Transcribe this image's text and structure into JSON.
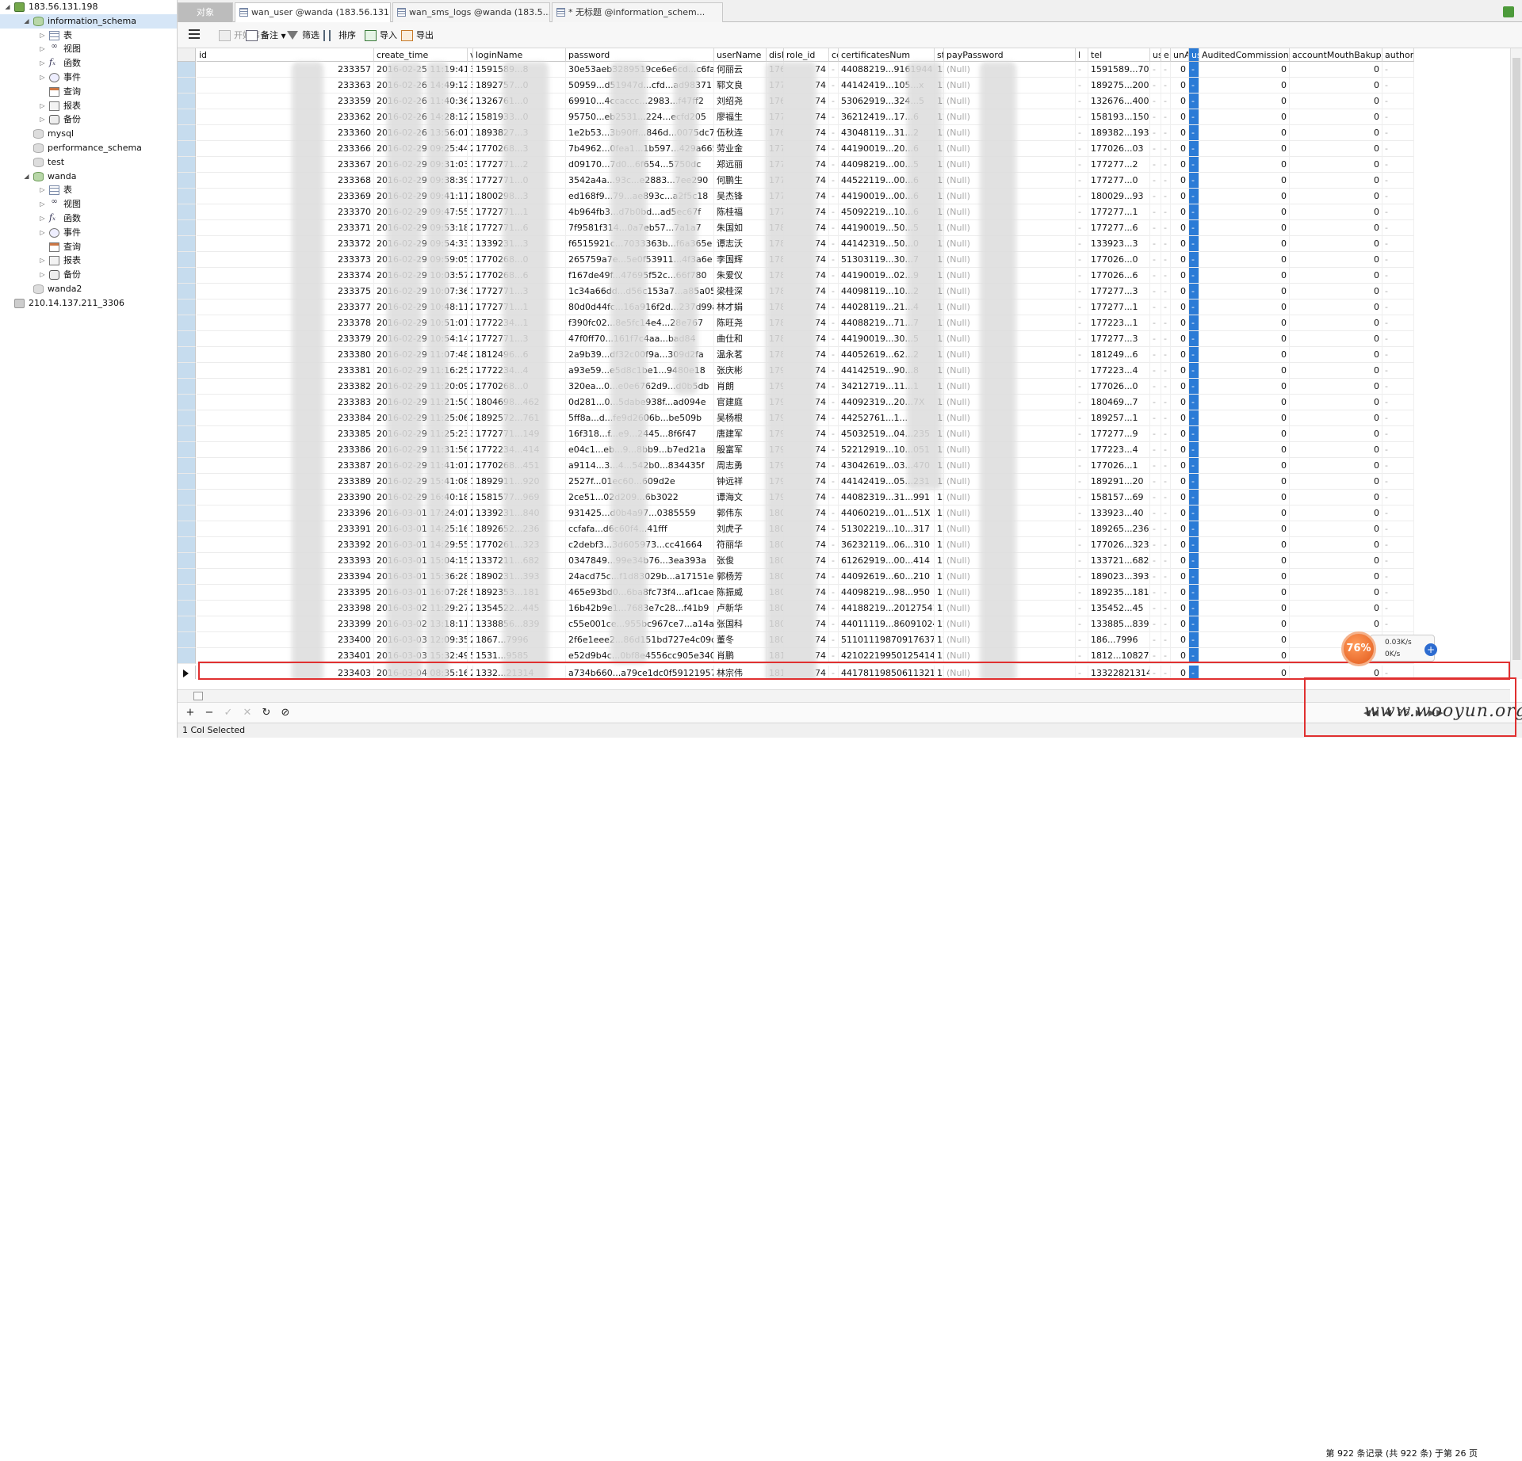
{
  "left_tree": [
    {
      "label": "183.56.131.198",
      "kind": "server",
      "depth": 0,
      "twist": "◢"
    },
    {
      "label": "information_schema",
      "kind": "db",
      "depth": 1,
      "twist": "◢",
      "selected": true
    },
    {
      "label": "表",
      "kind": "grid",
      "depth": 2,
      "twist": "▷"
    },
    {
      "label": "视图",
      "kind": "glasses",
      "depth": 2,
      "twist": "▷"
    },
    {
      "label": "函数",
      "kind": "fx",
      "depth": 2,
      "twist": "▷"
    },
    {
      "label": "事件",
      "kind": "event",
      "depth": 2,
      "twist": "▷"
    },
    {
      "label": "查询",
      "kind": "query",
      "depth": 2,
      "twist": ""
    },
    {
      "label": "报表",
      "kind": "report",
      "depth": 2,
      "twist": "▷"
    },
    {
      "label": "备份",
      "kind": "backup",
      "depth": 2,
      "twist": "▷"
    },
    {
      "label": "mysql",
      "kind": "db-dim",
      "depth": 1,
      "twist": ""
    },
    {
      "label": "performance_schema",
      "kind": "db-dim",
      "depth": 1,
      "twist": ""
    },
    {
      "label": "test",
      "kind": "db-dim",
      "depth": 1,
      "twist": ""
    },
    {
      "label": "wanda",
      "kind": "db",
      "depth": 1,
      "twist": "◢"
    },
    {
      "label": "表",
      "kind": "grid",
      "depth": 2,
      "twist": "▷"
    },
    {
      "label": "视图",
      "kind": "glasses",
      "depth": 2,
      "twist": "▷"
    },
    {
      "label": "函数",
      "kind": "fx",
      "depth": 2,
      "twist": "▷"
    },
    {
      "label": "事件",
      "kind": "event",
      "depth": 2,
      "twist": "▷"
    },
    {
      "label": "查询",
      "kind": "query",
      "depth": 2,
      "twist": ""
    },
    {
      "label": "报表",
      "kind": "report",
      "depth": 2,
      "twist": "▷"
    },
    {
      "label": "备份",
      "kind": "backup",
      "depth": 2,
      "twist": "▷"
    },
    {
      "label": "wanda2",
      "kind": "db-dim",
      "depth": 1,
      "twist": ""
    },
    {
      "label": "210.14.137.211_3306",
      "kind": "server-dim",
      "depth": 0,
      "twist": ""
    }
  ],
  "tabs": [
    {
      "label": "对象",
      "kind": "obj"
    },
    {
      "label": "wan_user @wanda (183.56.131....",
      "kind": "table",
      "active": true
    },
    {
      "label": "wan_sms_logs @wanda (183.5...",
      "kind": "table"
    },
    {
      "label": "* 无标题 @information_schem...",
      "kind": "query"
    }
  ],
  "toolbar": {
    "begin_transaction": "开始事务",
    "memo": "备注",
    "filter": "筛选",
    "sort": "排序",
    "import": "导入",
    "export": "导出"
  },
  "columns": [
    "id",
    "create_time",
    "v",
    "loginName",
    "password",
    "userName",
    "disIc",
    "role_id",
    "cе",
    "certificatesNum",
    "sta",
    "payPassword",
    "l",
    "tel",
    "use",
    "e",
    "unA",
    "us",
    "AuditedCommission",
    "accountMouthBakup",
    "author"
  ],
  "null_text": "(Null)",
  "rows": [
    {
      "id": "233357",
      "ct": "2016-02-25 11:19:41",
      "v": "3",
      "login": "1591589...8",
      "pw": "30e53aeb3289519ce6e6cd...c6faf1c",
      "user": "何丽云",
      "dis": "1766",
      "role": "74",
      "cert": "44088219...9161944",
      "sta": "12",
      "tel": "1591589...708",
      "ac": "0",
      "am": "0"
    },
    {
      "id": "233363",
      "ct": "2016-02-26 14:49:12",
      "v": "3",
      "login": "1892757...0",
      "pw": "50959...d51947d...cfd...ad98371",
      "user": "郓文良",
      "dis": "1772",
      "role": "74",
      "cert": "44142419...105...x",
      "sta": "12",
      "tel": "189275...200",
      "ac": "0",
      "am": "0"
    },
    {
      "id": "233359",
      "ct": "2016-02-26 11:40:36",
      "v": "2",
      "login": "1326761...0",
      "pw": "69910...4ccaccc...2983...f47ff2",
      "user": "刘绍尧",
      "dis": "1768",
      "role": "74",
      "cert": "53062919...324...5",
      "sta": "12",
      "tel": "132676...400",
      "ac": "0",
      "am": "0"
    },
    {
      "id": "233362",
      "ct": "2016-02-26 14:28:12",
      "v": "2",
      "login": "1581933...0",
      "pw": "95750...eb2531...224...ecfd205",
      "user": "廖福生",
      "dis": "1771",
      "role": "74",
      "cert": "36212419...17...6",
      "sta": "12",
      "tel": "158193...150",
      "ac": "0",
      "am": "0"
    },
    {
      "id": "233360",
      "ct": "2016-02-26 13:56:01",
      "v": "1",
      "login": "1893827...3",
      "pw": "1e2b53...3b90ff...846d...0075dc7",
      "user": "伍秋连",
      "dis": "1769",
      "role": "74",
      "cert": "43048119...31...2",
      "sta": "12",
      "tel": "189382...193",
      "ac": "0",
      "am": "0"
    },
    {
      "id": "233366",
      "ct": "2016-02-29 09:25:44",
      "v": "2",
      "login": "1770268...3",
      "pw": "7b4962...0fea1...1b597...429a665",
      "user": "劳业金",
      "dis": "1775",
      "role": "74",
      "cert": "44190019...20...6",
      "sta": "12",
      "tel": "177026...03",
      "ac": "0",
      "am": "0"
    },
    {
      "id": "233367",
      "ct": "2016-02-29 09:31:03",
      "v": "1",
      "login": "1772771...2",
      "pw": "d09170...7d0...6f654...5750dc",
      "user": "郑远丽",
      "dis": "1776",
      "role": "74",
      "cert": "44098219...00...5",
      "sta": "12",
      "tel": "177277...2",
      "ac": "0",
      "am": "0"
    },
    {
      "id": "233368",
      "ct": "2016-02-29 09:38:39",
      "v": "1",
      "login": "1772771...0",
      "pw": "3542a4a...93c...e2883...7ee290",
      "user": "何鹏生",
      "dis": "1777",
      "role": "74",
      "cert": "44522119...00...6",
      "sta": "12",
      "tel": "177277...0",
      "ac": "0",
      "am": "0"
    },
    {
      "id": "233369",
      "ct": "2016-02-29 09:41:11",
      "v": "2",
      "login": "1800298...3",
      "pw": "ed168f9...79...ae893c...a2f5c18",
      "user": "吴杰锋",
      "dis": "1778",
      "role": "74",
      "cert": "44190019...00...6",
      "sta": "12",
      "tel": "180029...93",
      "ac": "0",
      "am": "0"
    },
    {
      "id": "233370",
      "ct": "2016-02-29 09:47:55",
      "v": "1",
      "login": "1772771...1",
      "pw": "4b964fb3...d7b0bd...ad5ec67f",
      "user": "陈桂福",
      "dis": "1779",
      "role": "74",
      "cert": "45092219...10...6",
      "sta": "12",
      "tel": "177277...1",
      "ac": "0",
      "am": "0"
    },
    {
      "id": "233371",
      "ct": "2016-02-29 09:53:18",
      "v": "2",
      "login": "1772771...6",
      "pw": "7f9581f314...0a7eb57...7a1a7",
      "user": "朱国如",
      "dis": "1780",
      "role": "74",
      "cert": "44190019...50...5",
      "sta": "12",
      "tel": "177277...6",
      "ac": "0",
      "am": "0"
    },
    {
      "id": "233372",
      "ct": "2016-02-29 09:54:33",
      "v": "1",
      "login": "1339231...3",
      "pw": "f6515921c...7033363b...f6a365e",
      "user": "谭志沃",
      "dis": "1781",
      "role": "74",
      "cert": "44142319...50...0",
      "sta": "12",
      "tel": "133923...3",
      "ac": "0",
      "am": "0"
    },
    {
      "id": "233373",
      "ct": "2016-02-29 09:59:05",
      "v": "1",
      "login": "1770268...0",
      "pw": "265759a7e...5e0f53911...4f3a6e",
      "user": "李国辉",
      "dis": "1782",
      "role": "74",
      "cert": "51303119...30...7",
      "sta": "12",
      "tel": "177026...0",
      "ac": "0",
      "am": "0"
    },
    {
      "id": "233374",
      "ct": "2016-02-29 10:03:57",
      "v": "2",
      "login": "1770268...6",
      "pw": "f167de49f...47695f52c...66f780",
      "user": "朱爱仪",
      "dis": "1783",
      "role": "74",
      "cert": "44190019...02...9",
      "sta": "12",
      "tel": "177026...6",
      "ac": "0",
      "am": "0"
    },
    {
      "id": "233375",
      "ct": "2016-02-29 10:07:36",
      "v": "1",
      "login": "1772771...3",
      "pw": "1c34a66dd...d56c153a7...a85a057",
      "user": "梁桂深",
      "dis": "1784",
      "role": "74",
      "cert": "44098119...10...2",
      "sta": "12",
      "tel": "177277...3",
      "ac": "0",
      "am": "0"
    },
    {
      "id": "233377",
      "ct": "2016-02-29 10:48:11",
      "v": "2",
      "login": "1772771...1",
      "pw": "80d0d44fc...16a916f2d...237d99a",
      "user": "林才娟",
      "dis": "1786",
      "role": "74",
      "cert": "44028119...21...4",
      "sta": "12",
      "tel": "177277...1",
      "ac": "0",
      "am": "0"
    },
    {
      "id": "233378",
      "ct": "2016-02-29 10:51:01",
      "v": "3",
      "login": "1772234...1",
      "pw": "f390fc02...8e5fc14e4...28e767",
      "user": "陈旺尧",
      "dis": "1787",
      "role": "74",
      "cert": "44088219...71...7",
      "sta": "12",
      "tel": "177223...1",
      "ac": "0",
      "am": "0"
    },
    {
      "id": "233379",
      "ct": "2016-02-29 10:54:14",
      "v": "2",
      "login": "1772771...3",
      "pw": "47f0ff70...161f7c4aa...bad84",
      "user": "曲仕和",
      "dis": "1788",
      "role": "74",
      "cert": "44190019...30...5",
      "sta": "12",
      "tel": "177277...3",
      "ac": "0",
      "am": "0"
    },
    {
      "id": "233380",
      "ct": "2016-02-29 11:07:48",
      "v": "2",
      "login": "1812496...6",
      "pw": "2a9b39...df32c00f9a...309d2fa",
      "user": "温永茗",
      "dis": "1789",
      "role": "74",
      "cert": "44052619...62...2",
      "sta": "12",
      "tel": "181249...6",
      "ac": "0",
      "am": "0"
    },
    {
      "id": "233381",
      "ct": "2016-02-29 11:16:25",
      "v": "2",
      "login": "1772234...4",
      "pw": "a93e59...e5d8c1be1...9480e18",
      "user": "张庆彬",
      "dis": "1790",
      "role": "74",
      "cert": "44142519...90...8",
      "sta": "12",
      "tel": "177223...4",
      "ac": "0",
      "am": "0"
    },
    {
      "id": "233382",
      "ct": "2016-02-29 11:20:09",
      "v": "2",
      "login": "1770268...0",
      "pw": "320ea...0...e0e6762d9...d0b5db",
      "user": "肖朗",
      "dis": "1791",
      "role": "74",
      "cert": "34212719...11...1",
      "sta": "12",
      "tel": "177026...0",
      "ac": "0",
      "am": "0"
    },
    {
      "id": "233383",
      "ct": "2016-02-29 11:21:50",
      "v": "1",
      "login": "1804698...462",
      "pw": "0d281...0...5dabe938f...ad094e",
      "user": "官建庭",
      "dis": "1792",
      "role": "74",
      "cert": "44092319...20...7X",
      "sta": "12",
      "tel": "180469...7",
      "ac": "0",
      "am": "0"
    },
    {
      "id": "233384",
      "ct": "2016-02-29 11:25:06",
      "v": "2",
      "login": "1892572...761",
      "pw": "5ff8a...d...fe9d2606b...be509b",
      "user": "吴杨根",
      "dis": "1793",
      "role": "74",
      "cert": "44252761...1...",
      "sta": "12",
      "tel": "189257...1",
      "ac": "0",
      "am": "0"
    },
    {
      "id": "233385",
      "ct": "2016-02-29 11:25:23",
      "v": "3",
      "login": "1772771...149",
      "pw": "16f318...f...e9...2445...8f6f47",
      "user": "唐建军",
      "dis": "1794",
      "role": "74",
      "cert": "45032519...04...235",
      "sta": "12",
      "tel": "177277...9",
      "ac": "0",
      "am": "0"
    },
    {
      "id": "233386",
      "ct": "2016-02-29 11:31:56",
      "v": "2",
      "login": "1772234...414",
      "pw": "e04c1...eb...9...8bb9...b7ed21a",
      "user": "殷富军",
      "dis": "1795",
      "role": "74",
      "cert": "52212919...10...051",
      "sta": "12",
      "tel": "177223...4",
      "ac": "0",
      "am": "0"
    },
    {
      "id": "233387",
      "ct": "2016-02-29 11:41:01",
      "v": "2",
      "login": "1770268...451",
      "pw": "a9114...3...4...542b0...834435f",
      "user": "周志勇",
      "dis": "1796",
      "role": "74",
      "cert": "43042619...03...470",
      "sta": "12",
      "tel": "177026...1",
      "ac": "0",
      "am": "0"
    },
    {
      "id": "233389",
      "ct": "2016-02-29 15:41:08",
      "v": "1",
      "login": "1892911...920",
      "pw": "2527f...01ec60...609d2e",
      "user": "钟远祥",
      "dis": "1798",
      "role": "74",
      "cert": "44142419...05...231",
      "sta": "12",
      "tel": "189291...20",
      "ac": "0",
      "am": "0"
    },
    {
      "id": "233390",
      "ct": "2016-02-29 16:40:18",
      "v": "2",
      "login": "1581577...969",
      "pw": "2ce51...02d209...6b3022",
      "user": "谭海文",
      "dis": "1799",
      "role": "74",
      "cert": "44082319...31...991",
      "sta": "12",
      "tel": "158157...69",
      "ac": "0",
      "am": "0"
    },
    {
      "id": "233396",
      "ct": "2016-03-01 17:24:01",
      "v": "2",
      "login": "1339231...840",
      "pw": "931425...d0b4a97...0385559",
      "user": "郭伟东",
      "dis": "1805",
      "role": "74",
      "cert": "44060219...01...51X",
      "sta": "12",
      "tel": "133923...40",
      "ac": "0",
      "am": "0"
    },
    {
      "id": "233391",
      "ct": "2016-03-01 14:25:16",
      "v": "1",
      "login": "1892652...236",
      "pw": "ccfafa...d6c60f4...41fff",
      "user": "刘虎子",
      "dis": "1800",
      "role": "74",
      "cert": "51302219...10...317",
      "sta": "12",
      "tel": "189265...236",
      "ac": "0",
      "am": "0"
    },
    {
      "id": "233392",
      "ct": "2016-03-01 14:29:55",
      "v": "1",
      "login": "1770261...323",
      "pw": "c2debf3...3d605973...cc41664",
      "user": "符丽华",
      "dis": "1801",
      "role": "74",
      "cert": "36232119...06...310",
      "sta": "12",
      "tel": "177026...323",
      "ac": "0",
      "am": "0"
    },
    {
      "id": "233393",
      "ct": "2016-03-01 15:04:15",
      "v": "2",
      "login": "1337211...682",
      "pw": "0347849...99e34b76...3ea393a",
      "user": "张俊",
      "dis": "1802",
      "role": "74",
      "cert": "61262919...00...414",
      "sta": "12",
      "tel": "133721...682",
      "ac": "0",
      "am": "0"
    },
    {
      "id": "233394",
      "ct": "2016-03-01 15:36:28",
      "v": "1",
      "login": "1890231...393",
      "pw": "24acd75c...f1d83029b...a17151e",
      "user": "郭杨芳",
      "dis": "1803",
      "role": "74",
      "cert": "44092619...60...210",
      "sta": "12",
      "tel": "189023...393",
      "ac": "0",
      "am": "0"
    },
    {
      "id": "233395",
      "ct": "2016-03-01 16:07:28",
      "v": "5",
      "login": "1892353...181",
      "pw": "465e93bd0...6ba8fc73f4...af1cae5",
      "user": "陈振威",
      "dis": "1804",
      "role": "74",
      "cert": "44098219...98...950",
      "sta": "12",
      "tel": "189235...181",
      "ac": "0",
      "am": "0"
    },
    {
      "id": "233398",
      "ct": "2016-03-02 11:29:27",
      "v": "2",
      "login": "1354522...445",
      "pw": "16b42b9e1...7683e7c28...f41b9",
      "user": "卢新华",
      "dis": "1807",
      "role": "74",
      "cert": "44188219...201275412",
      "sta": "12",
      "tel": "135452...45",
      "ac": "0",
      "am": "0"
    },
    {
      "id": "233399",
      "ct": "2016-03-02 13:18:11",
      "v": "1",
      "login": "1338856...839",
      "pw": "c55e001ce...955bc967ce7...a14ac228ec",
      "user": "张国科",
      "dis": "1808",
      "role": "74",
      "cert": "44011119...8609102457",
      "sta": "12",
      "tel": "133885...839",
      "ac": "0",
      "am": "0"
    },
    {
      "id": "233400",
      "ct": "2016-03-03 12:09:35",
      "v": "2",
      "login": "1867...7996",
      "pw": "2f6e1eee2...86d151bd727e4c09db6e",
      "user": "董冬",
      "dis": "1809",
      "role": "74",
      "cert": "51101119870917637",
      "sta": "12",
      "tel": "186...7996",
      "ac": "0",
      "am": "0"
    },
    {
      "id": "233401",
      "ct": "2016-03-03 15:32:49",
      "v": "5",
      "login": "1531...9585",
      "pw": "e52d9b4c...0bf8e4556cc905e340912",
      "user": "肖鹏",
      "dis": "1811",
      "role": "74",
      "cert": "42102219950125414",
      "sta": "12",
      "tel": "1812...10827",
      "ac": "0",
      "am": "0"
    },
    {
      "id": "233403",
      "ct": "2016-03-04 08:35:16",
      "v": "2",
      "login": "1332...21314",
      "pw": "a734b660...a79ce1dc0f59121957513",
      "user": "林宗伟",
      "dis": "1812",
      "role": "74",
      "cert": "44178119850611321X",
      "sta": "12",
      "tel": "13322821314",
      "ac": "0",
      "am": "0",
      "current": true
    }
  ],
  "bottom_buttons": [
    "+",
    "−",
    "✓",
    "✕",
    "↻",
    "⊘"
  ],
  "status": {
    "selected": "1 Col Selected",
    "records": "第 922 条记录 (共 922 条) 于第 26 页"
  },
  "watermark": "www.wooyun.org",
  "network": {
    "percent": "76%",
    "up": "0.03K/s",
    "down": "0K/s"
  }
}
